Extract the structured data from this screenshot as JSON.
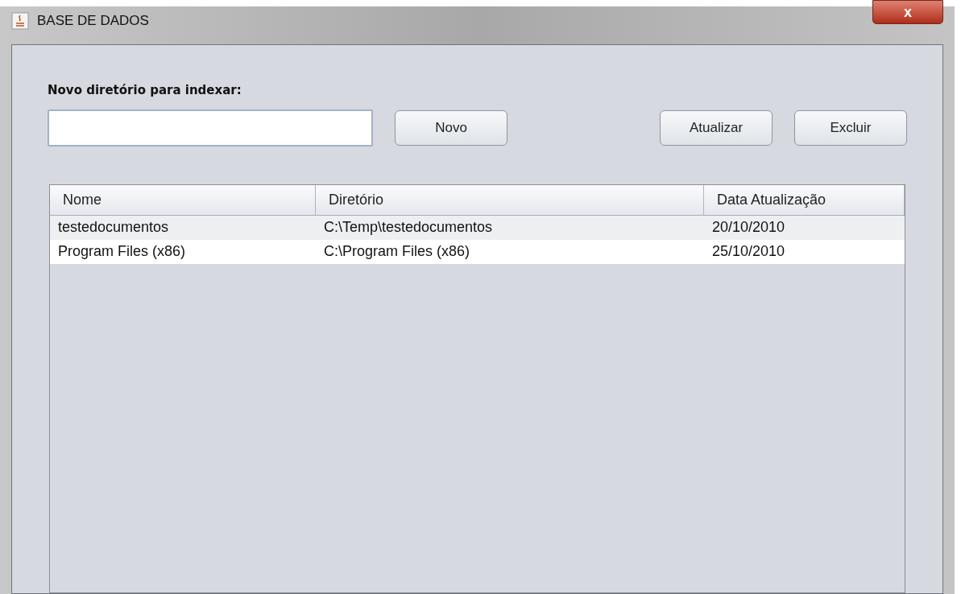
{
  "window": {
    "title": "BASE DE DADOS",
    "close_label": "x"
  },
  "form": {
    "label": "Novo diretório para indexar:",
    "buttons": [
      "Novo",
      "Atualizar",
      "Excluir"
    ]
  },
  "table": {
    "columns": [
      "Nome",
      "Diretório",
      "Data Atualização"
    ],
    "rows": [
      {
        "cells": [
          "testedocumentos",
          "C:\\Temp\\testedocumentos",
          "20/10/2010"
        ]
      },
      {
        "cells": [
          "Program Files (x86)",
          "C:\\Program Files (x86)",
          "25/10/2010"
        ]
      }
    ]
  }
}
